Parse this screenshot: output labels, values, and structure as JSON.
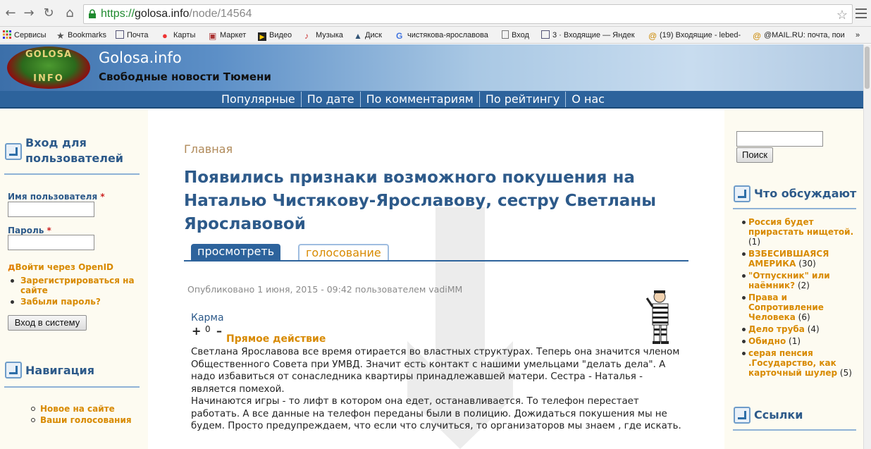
{
  "browser": {
    "url_scheme": "https://",
    "url_host": "golosa.info",
    "url_path": "/node/14564",
    "bookmarks": [
      "Сервисы",
      "Bookmarks",
      "Почта",
      "Карты",
      "Маркет",
      "Видео",
      "Музыка",
      "Диск",
      "чистякова-ярославова",
      "Вход",
      "3 · Входящие — Яндек",
      "(19) Входящие - lebed-",
      "@MAIL.RU: почта, пои"
    ]
  },
  "site": {
    "logo_top": "GOLOSA",
    "logo_bottom": "INFO",
    "name": "Golosa.info",
    "slogan": "Свободные новости Тюмени"
  },
  "topnav": [
    "Популярные",
    "По дате",
    "По комментариям",
    "По рейтингу",
    "О нас"
  ],
  "login": {
    "title": "Вход для пользователей",
    "username_label": "Имя пользователя",
    "password_label": "Пароль",
    "required_mark": "*",
    "openid_link": "Войти через OpenID",
    "links": [
      "Зарегистрироваться на сайте",
      "Забыли пароль?"
    ],
    "submit": "Вход в систему"
  },
  "navigation": {
    "title": "Навигация",
    "links": [
      "Новое на сайте",
      "Ваши голосования"
    ]
  },
  "main": {
    "breadcrumb": "Главная",
    "title": "Появились признаки возможного покушения на Наталью Чистякову-Ярославову, сестру Светланы Ярославовой",
    "tabs": [
      "просмотреть",
      "голосование"
    ],
    "submitted": "Опубликовано 1 июня, 2015 - 09:42 пользователем vadiMM",
    "karma_label": "Карма",
    "karma_plus": "+",
    "karma_value": "0",
    "karma_minus": "–",
    "term": "Прямое действие",
    "paragraphs": [
      "Светлана Ярославова все время отирается во властных структурах. Теперь она значится членом Общественного Совета при УМВД. Значит есть контакт с нашими умельцами \"делать дела\". А надо избавиться от сонаследника квартиры принадлежавшей матери. Сестра - Наталья - является помехой.",
      "Начинаются игры - то лифт в котором она едет, останавливается. То телефон перестает работать. А все данные на телефон переданы были в полицию. Дожидаться покушения мы не будем. Просто предупреждаем, что если что случиться, то организаторов мы знаем , где искать."
    ]
  },
  "search": {
    "button": "Поиск",
    "value": ""
  },
  "discussion": {
    "title": "Что обсуждают",
    "items": [
      {
        "title": "Россия будет прирастать нищетой.",
        "count": "(1)"
      },
      {
        "title": "ВЗБЕСИВШАЯСЯ АМЕРИКА",
        "count": "(30)"
      },
      {
        "title": "\"Отпускник\" или наёмник?",
        "count": "(2)"
      },
      {
        "title": "Права и Сопротивление Человека",
        "count": "(6)"
      },
      {
        "title": "Дело труба",
        "count": "(4)"
      },
      {
        "title": "Обидно",
        "count": "(1)"
      },
      {
        "title": "серая пенсия .Государство, как карточный шулер",
        "count": "(5)"
      }
    ]
  },
  "links_block": {
    "title": "Ссылки"
  },
  "colors": {
    "accent_blue": "#2d639c",
    "heading_blue": "#2d5a8a",
    "link_orange": "#d88a00",
    "sidebar_bg": "#fdfbf1"
  }
}
